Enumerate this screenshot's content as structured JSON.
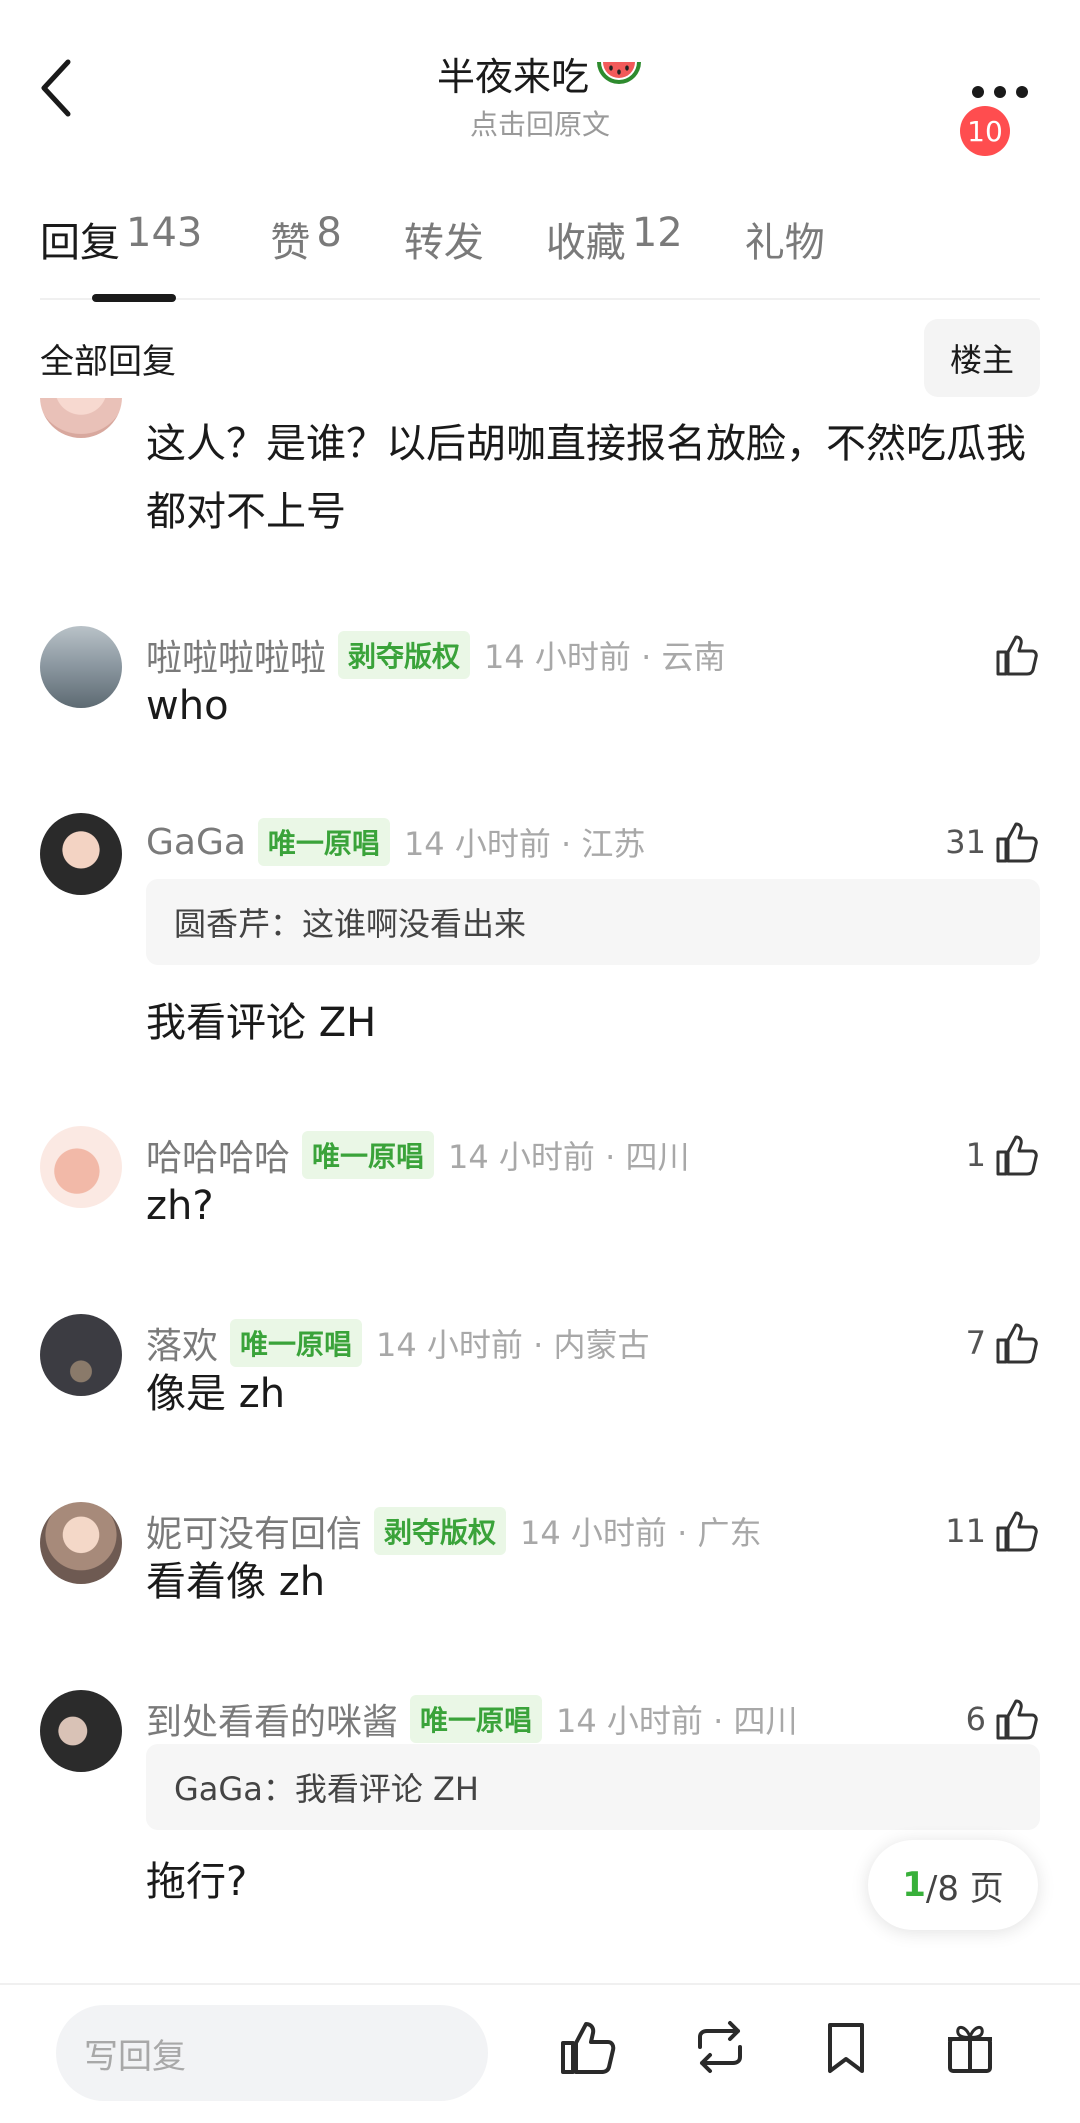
{
  "header": {
    "title": "半夜来吃",
    "subtitle": "点击回原文",
    "badge_count": "10"
  },
  "tabs": [
    {
      "label": "回复",
      "count": "143",
      "active": true
    },
    {
      "label": "赞",
      "count": "8",
      "active": false
    },
    {
      "label": "转发",
      "count": "",
      "active": false
    },
    {
      "label": "收藏",
      "count": "12",
      "active": false
    },
    {
      "label": "礼物",
      "count": "",
      "active": false
    }
  ],
  "filter": {
    "label": "全部回复",
    "owner_button": "楼主"
  },
  "comments": [
    {
      "text": "这人？是谁？以后胡咖直接报名放脸，不然吃瓜我都对不上号"
    },
    {
      "username": "啦啦啦啦啦",
      "tag": "剥夺版权",
      "time": "14 小时前 · 云南",
      "likes": "",
      "text": "who"
    },
    {
      "username": "GaGa",
      "tag": "唯一原唱",
      "time": "14 小时前 · 江苏",
      "likes": "31",
      "quote": "圆香芹：这谁啊没看出来",
      "text": "我看评论 ZH"
    },
    {
      "username": "哈哈哈哈",
      "tag": "唯一原唱",
      "time": "14 小时前 · 四川",
      "likes": "1",
      "text": "zh?"
    },
    {
      "username": "落欢",
      "tag": "唯一原唱",
      "time": "14 小时前 · 内蒙古",
      "likes": "7",
      "text": "像是 zh"
    },
    {
      "username": "妮可没有回信",
      "tag": "剥夺版权",
      "time": "14 小时前 · 广东",
      "likes": "11",
      "text": "看着像 zh"
    },
    {
      "username": "到处看看的咪酱",
      "tag": "唯一原唱",
      "time": "14 小时前 · 四川",
      "likes": "6",
      "quote": "GaGa：我看评论 ZH",
      "text": "拖行?"
    }
  ],
  "pagination": {
    "current": "1",
    "total_text": "/8 页"
  },
  "bottom_bar": {
    "reply_placeholder": "写回复"
  },
  "colors": {
    "tag_green": "#3aa33a",
    "tag_bg": "#eaf7e6",
    "badge_red": "#ff4d4f"
  }
}
